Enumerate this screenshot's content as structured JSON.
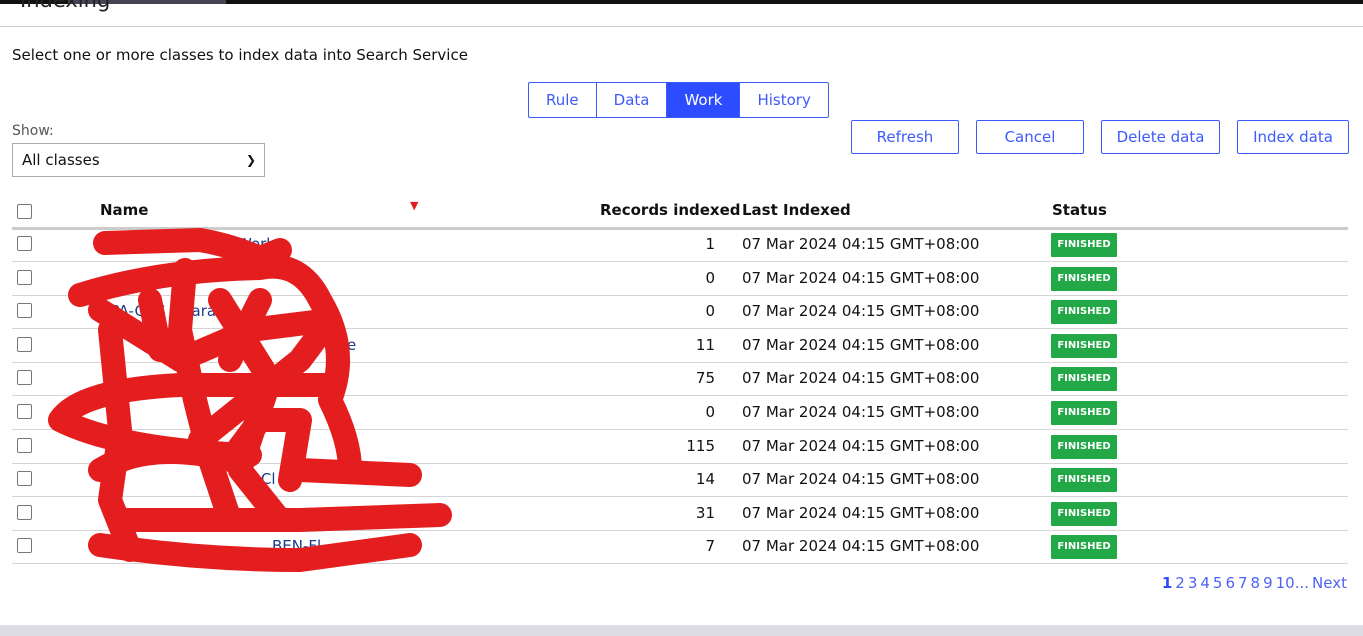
{
  "page": {
    "title": "Indexing",
    "intro": "Select one or more classes to index data into Search Service"
  },
  "tabs": [
    {
      "label": "Rule",
      "active": false
    },
    {
      "label": "Data",
      "active": false
    },
    {
      "label": "Work",
      "active": true
    },
    {
      "label": "History",
      "active": false
    }
  ],
  "filter": {
    "label": "Show:",
    "value": "All classes"
  },
  "buttons": {
    "refresh": "Refresh",
    "cancel": "Cancel",
    "delete": "Delete data",
    "index": "Index data"
  },
  "table": {
    "headers": {
      "name": "Name",
      "records": "Records indexed",
      "last": "Last Indexed",
      "status": "Status"
    },
    "rows": [
      {
        "name": "Work",
        "records": "1",
        "last": "07 Mar 2024 04:15 GMT+08:00",
        "status": "FINISHED"
      },
      {
        "name": "",
        "records": "0",
        "last": "07 Mar 2024 04:15 GMT+08:00",
        "status": "FINISHED"
      },
      {
        "name": "CPA-GBS Guarantee",
        "records": "0",
        "last": "07 Mar 2024 04:15 GMT+08:00",
        "status": "FINISHED"
      },
      {
        "name": "e",
        "records": "11",
        "last": "07 Mar 2024 04:15 GMT+08:00",
        "status": "FINISHED"
      },
      {
        "name": "",
        "records": "75",
        "last": "07 Mar 2024 04:15 GMT+08:00",
        "status": "FINISHED"
      },
      {
        "name": "",
        "records": "0",
        "last": "07 Mar 2024 04:15 GMT+08:00",
        "status": "FINISHED"
      },
      {
        "name": "",
        "records": "115",
        "last": "07 Mar 2024 04:15 GMT+08:00",
        "status": "FINISHED"
      },
      {
        "name": "k- Cl",
        "records": "14",
        "last": "07 Mar 2024 04:15 GMT+08:00",
        "status": "FINISHED"
      },
      {
        "name": "",
        "records": "31",
        "last": "07 Mar 2024 04:15 GMT+08:00",
        "status": "FINISHED"
      },
      {
        "name": "BEN-Fl",
        "records": "7",
        "last": "07 Mar 2024 04:15 GMT+08:00",
        "status": "FINISHED"
      }
    ]
  },
  "pagination": {
    "pages": [
      "1",
      "2",
      "3",
      "4",
      "5",
      "6",
      "7",
      "8",
      "9",
      "10..."
    ],
    "current": "1",
    "next": "Next"
  },
  "colors": {
    "accent": "#2e4cff",
    "finished": "#22a846",
    "redaction": "#e41e1e"
  }
}
